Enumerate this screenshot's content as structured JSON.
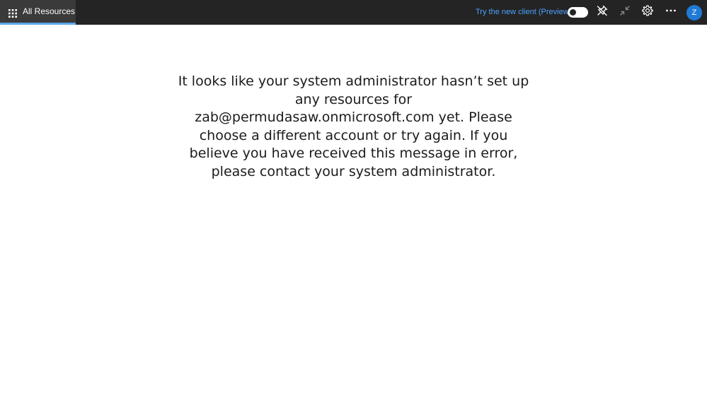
{
  "topbar": {
    "all_resources_label": "All Resources",
    "try_new_client_label": "Try the new client (Preview)",
    "toggle_state": "off",
    "avatar_initial": "Z",
    "icons": [
      "apps-grid-icon",
      "unpin-icon",
      "collapse-icon",
      "gear-icon",
      "more-icon"
    ]
  },
  "main": {
    "message": "It looks like your system administrator hasn’t set up any resources for zab@permudasaw.onmicrosoft.com yet. Please choose a different account or try again. If you believe you have received this message in error, please contact your system administrator."
  },
  "colors": {
    "topbar_bg": "#242424",
    "tab_active_bg": "#3a3a3a",
    "tab_underline": "#5aa7e6",
    "link": "#4aa3ff",
    "avatar_bg": "#1f7ad6"
  }
}
